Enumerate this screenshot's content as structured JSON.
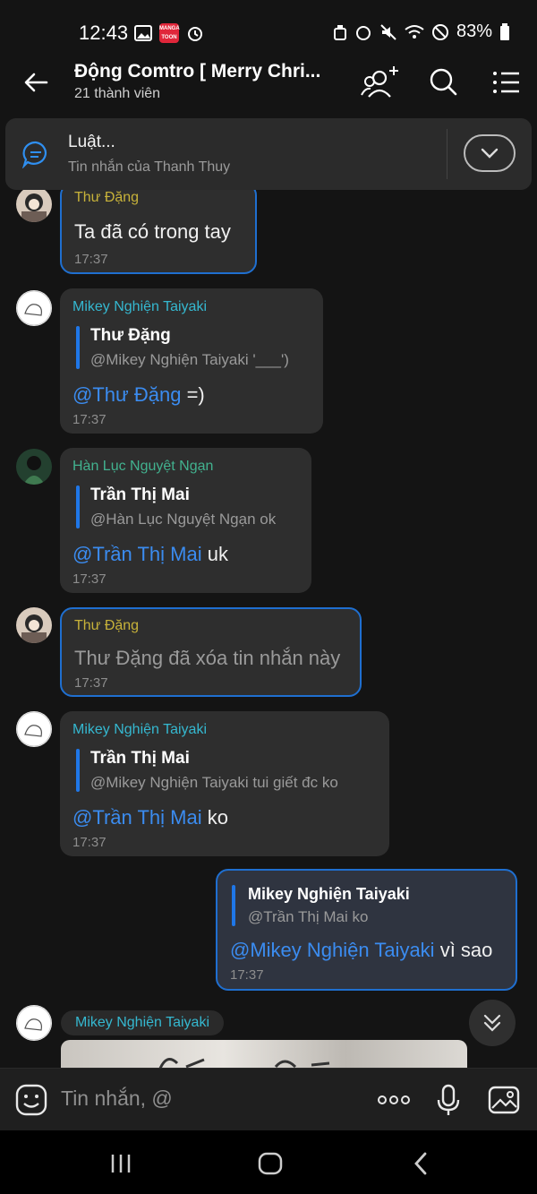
{
  "status": {
    "time": "12:43",
    "battery": "83%"
  },
  "header": {
    "title": "Động Comtro [ Merry Chri...",
    "subtitle": "21 thành viên"
  },
  "pinned": {
    "title": "Luật...",
    "subtitle": "Tin nhắn của Thanh Thuy"
  },
  "messages": [
    {
      "sender": "Thư Đặng",
      "text": "Ta đã có trong tay",
      "time": "17:37"
    },
    {
      "sender": "Mikey Nghiện Taiyaki",
      "quote_name": "Thư Đặng",
      "quote_text": "@Mikey Nghiện Taiyaki '___')",
      "mention": "@Thư Đặng",
      "text": " =)",
      "time": "17:37"
    },
    {
      "sender": "Hàn Lục Nguyệt Ngạn",
      "quote_name": "Trần Thị Mai",
      "quote_text": "@Hàn Lục Nguyệt Ngạn ok",
      "mention": "@Trần Thị Mai",
      "text": " uk",
      "time": "17:37"
    },
    {
      "sender": "Thư Đặng",
      "text": "Thư Đặng đã xóa tin nhắn này",
      "time": "17:37"
    },
    {
      "sender": "Mikey Nghiện Taiyaki",
      "quote_name": "Trần Thị Mai",
      "quote_text": "@Mikey Nghiện Taiyaki tui giết đc ko",
      "mention": "@Trần Thị Mai",
      "text": " ko",
      "time": "17:37"
    },
    {
      "quote_name": "Mikey Nghiện Taiyaki",
      "quote_text": "@Trần Thị Mai ko",
      "mention": "@Mikey Nghiện Taiyaki",
      "text": " vì sao",
      "time": "17:37"
    },
    {
      "sender": "Mikey Nghiện Taiyaki"
    }
  ],
  "input": {
    "placeholder": "Tin nhắn, @"
  },
  "icons": [
    "back-arrow-icon",
    "add-member-icon",
    "search-icon",
    "menu-list-icon",
    "chat-bubble-icon",
    "chevron-down-icon",
    "sticker-icon",
    "more-icon",
    "mic-icon",
    "gallery-icon"
  ]
}
